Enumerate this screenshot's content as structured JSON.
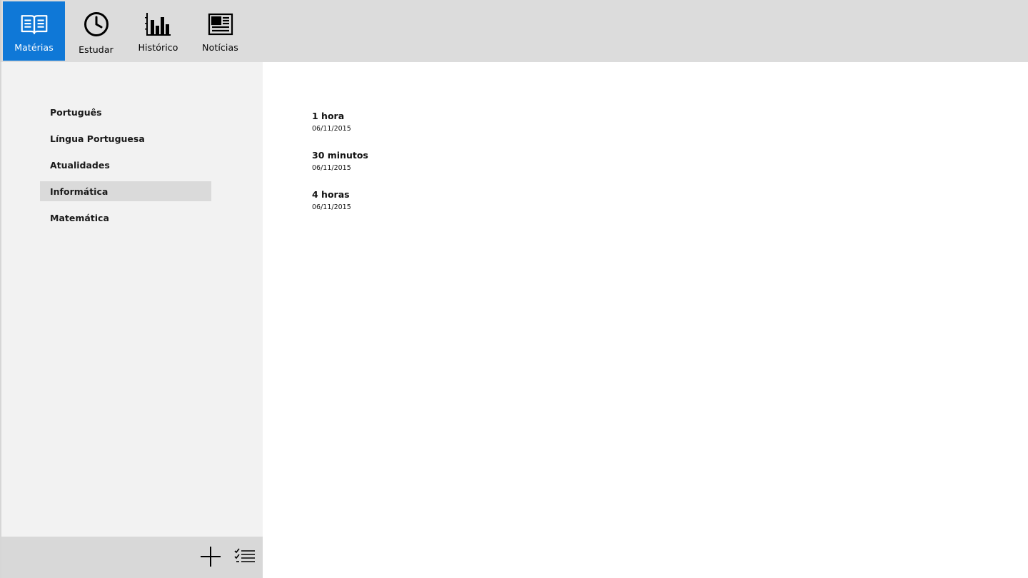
{
  "nav": {
    "items": [
      {
        "label": "Matérias",
        "icon": "open-book-icon",
        "active": true
      },
      {
        "label": "Estudar",
        "icon": "clock-icon",
        "active": false
      },
      {
        "label": "Histórico",
        "icon": "bar-chart-icon",
        "active": false
      },
      {
        "label": "Notícias",
        "icon": "newspaper-icon",
        "active": false
      }
    ]
  },
  "subjects": [
    {
      "label": "Português"
    },
    {
      "label": "Língua Portuguesa"
    },
    {
      "label": "Atualidades"
    },
    {
      "label": "Informática"
    },
    {
      "label": "Matemática"
    }
  ],
  "selected_subject": "Informática",
  "sessions": [
    {
      "duration": "1 hora",
      "date": "06/11/2015"
    },
    {
      "duration": "30 minutos",
      "date": "06/11/2015"
    },
    {
      "duration": "4 horas",
      "date": "06/11/2015"
    }
  ],
  "bottom_bar": {
    "add_icon": "plus-icon",
    "multiselect_icon": "checklist-icon"
  },
  "colors": {
    "accent": "#0f78d7",
    "topbar": "#dcdcdc",
    "left_pane": "#f2f2f2",
    "selected_item": "#dadada"
  }
}
